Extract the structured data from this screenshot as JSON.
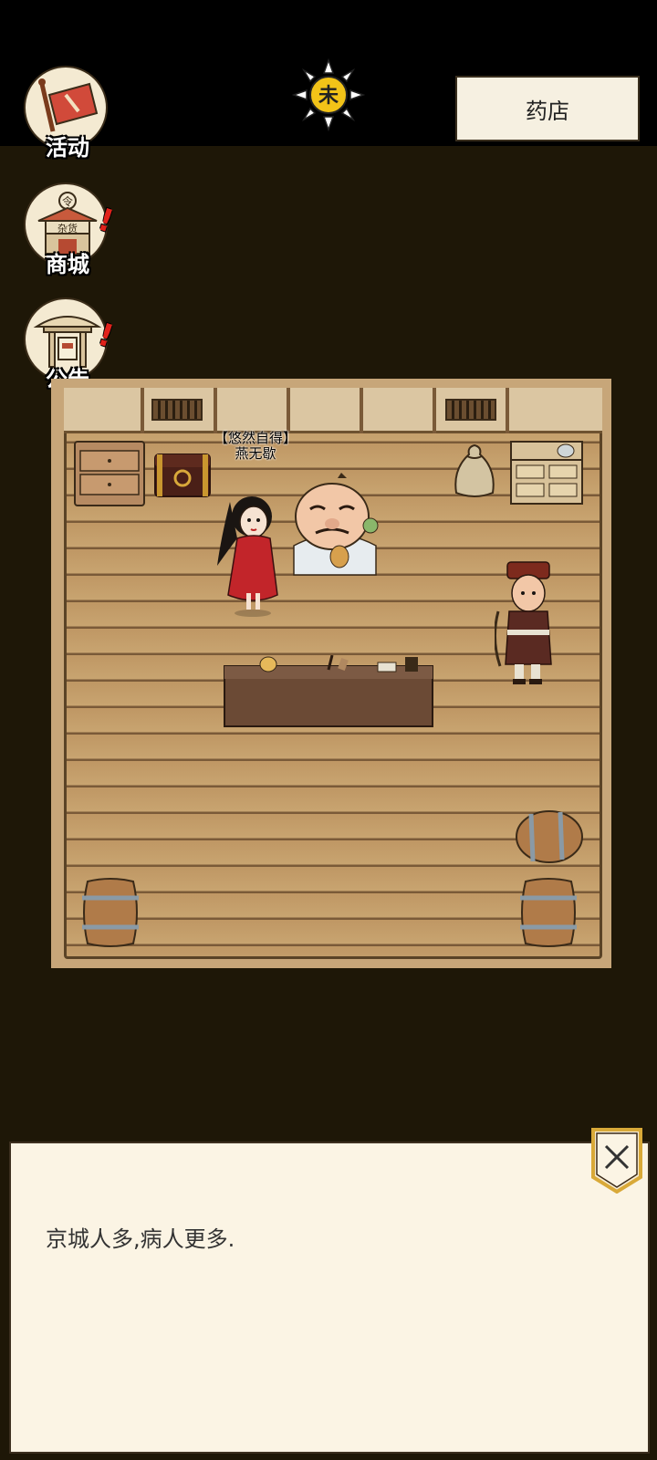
{
  "header": {
    "time_badge": "未",
    "location": "药店"
  },
  "side_menu": {
    "items": [
      {
        "label": "活动",
        "icon": "banner-flag-icon",
        "alert": false
      },
      {
        "label": "商城",
        "icon": "shop-stall-icon",
        "alert": true,
        "stall_sign": "杂货",
        "roof_glyph": "令"
      },
      {
        "label": "公告",
        "icon": "notice-pavilion-icon",
        "alert": true
      }
    ],
    "alert_mark": "!"
  },
  "scene": {
    "npc_title": "【悠然自得】",
    "npc_name": "燕无歇"
  },
  "dialog": {
    "text": "京城人多,病人更多.",
    "close_icon": "close-x-icon"
  },
  "colors": {
    "background": "#1e1707",
    "topbar": "#000000",
    "panel": "#fbf4e4",
    "alert": "#e0221b",
    "sun": "#f2c318"
  }
}
